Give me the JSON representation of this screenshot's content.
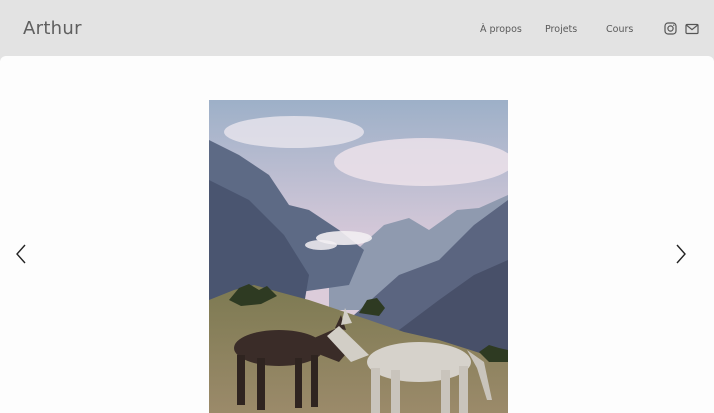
{
  "site": {
    "brand": "Arthur"
  },
  "nav": {
    "items": [
      "À propos",
      "Projets",
      "Cours"
    ]
  },
  "social": {
    "instagram_icon": "instagram-icon",
    "mail_icon": "mail-icon"
  },
  "gallery": {
    "prev_icon": "chevron-left-icon",
    "next_icon": "chevron-right-icon"
  },
  "colors": {
    "header_bg": "#e3e3e3",
    "page_bg": "#fdfdfd",
    "text": "#5a5a5a"
  }
}
